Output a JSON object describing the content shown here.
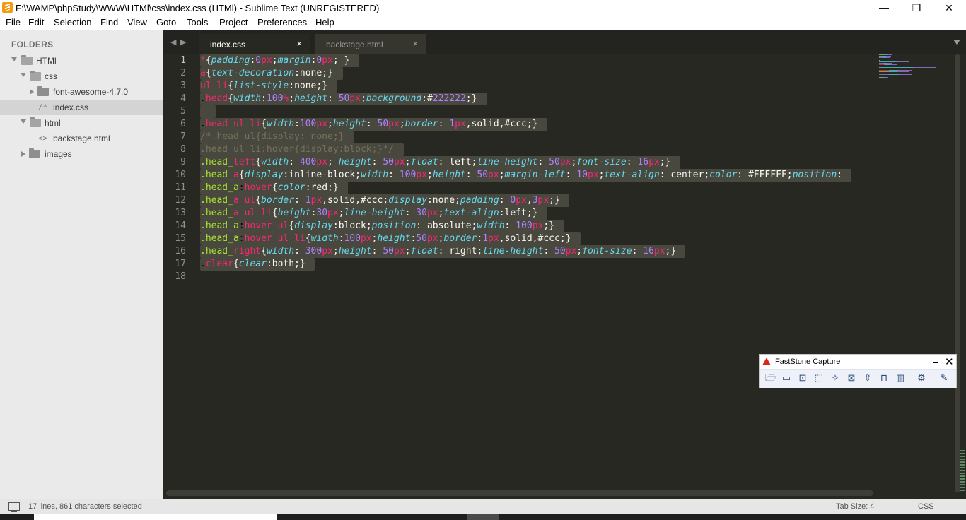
{
  "window": {
    "title": "F:\\WAMP\\phpStudy\\WWW\\HTMl\\css\\index.css (HTMl) - Sublime Text (UNREGISTERED)"
  },
  "menu": [
    "File",
    "Edit",
    "Selection",
    "Find",
    "View",
    "Goto",
    "Tools",
    "Project",
    "Preferences",
    "Help"
  ],
  "sidebar": {
    "header": "FOLDERS",
    "items": [
      {
        "label": "HTMl",
        "kind": "folder",
        "state": "expanded",
        "depth": 0
      },
      {
        "label": "css",
        "kind": "folder",
        "state": "expanded",
        "depth": 1
      },
      {
        "label": "font-awesome-4.7.0",
        "kind": "folder",
        "state": "collapsed",
        "depth": 2
      },
      {
        "label": "index.css",
        "kind": "file",
        "icon": "/*",
        "depth": 2,
        "selected": true
      },
      {
        "label": "html",
        "kind": "folder",
        "state": "expanded",
        "depth": 1
      },
      {
        "label": "backstage.html",
        "kind": "file",
        "icon": "<>",
        "depth": 2
      },
      {
        "label": "images",
        "kind": "folder",
        "state": "collapsed",
        "depth": 1
      }
    ]
  },
  "tabs": [
    {
      "label": "index.css",
      "active": true,
      "close": "×"
    },
    {
      "label": "backstage.html",
      "active": false,
      "close": "×"
    }
  ],
  "editor": {
    "line_numbers": [
      "1",
      "2",
      "3",
      "4",
      "5",
      "6",
      "7",
      "8",
      "9",
      "10",
      "11",
      "12",
      "13",
      "14",
      "15",
      "16",
      "17",
      "18"
    ],
    "lines": [
      "*{padding:0px;margin:0px; }",
      "a{text-decoration:none;}",
      "ul li{list-style:none;}",
      ".head{width:100%;height: 50px;background:#222222;}",
      " ",
      ".head ul li{width:100px;height: 50px;border: 1px,solid,#ccc;}",
      "/*.head ul{display: none;}",
      ".head ul li:hover{display:block;}*/",
      ".head_left{width: 400px; height: 50px;float: left;line-height: 50px;font-size: 16px;}",
      ".head_a{display:inline-block;width: 100px;height: 50px;margin-left: 10px;text-align: center;color: #FFFFFF;position:",
      ".head_a:hover{color:red;}",
      ".head_a ul{border: 1px,solid,#ccc;display:none;padding: 0px,3px;}",
      ".head_a ul li{height:30px;line-height: 30px;text-align:left;}",
      ".head_a:hover ul{display:block;position: absolute;width: 100px;}",
      ".head_a:hover ul li{width:100px;height:50px;border:1px,solid,#ccc;}",
      ".head_right{width: 300px;height: 50px;float: right;line-height: 50px;font-size: 16px;}",
      ".clear{clear:both;}",
      ""
    ]
  },
  "status": {
    "selection": "17 lines, 861 characters selected",
    "tab_size": "Tab Size: 4",
    "syntax": "CSS"
  },
  "faststone": {
    "title": "FastStone Capture"
  },
  "colors": {
    "bg": "#272822",
    "selector": "#a6e22e",
    "property": "#66d9ef",
    "number": "#ae81ff",
    "unit": "#f92672",
    "comment": "#75715e",
    "selection": "#49483e"
  }
}
